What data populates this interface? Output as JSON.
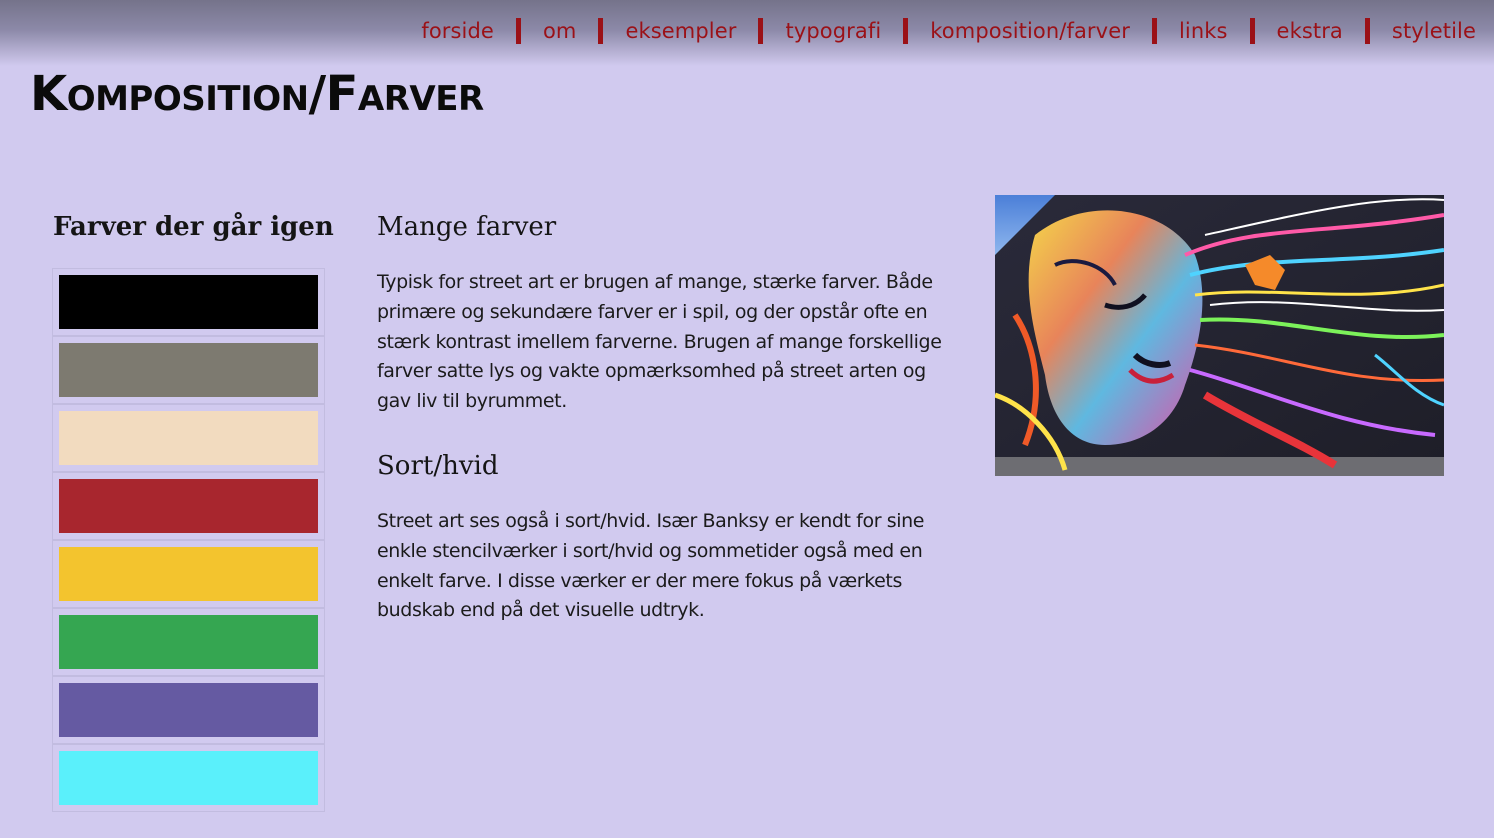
{
  "nav": {
    "items": [
      {
        "label": "forside"
      },
      {
        "label": "om"
      },
      {
        "label": "eksempler"
      },
      {
        "label": "typografi"
      },
      {
        "label": "komposition/farver"
      },
      {
        "label": "links"
      },
      {
        "label": "ekstra"
      },
      {
        "label": "styletile"
      }
    ],
    "link_color": "#9b1117"
  },
  "page": {
    "title": "Komposition/Farver"
  },
  "palette": {
    "heading": "Farver der går igen",
    "colors": [
      "#000000",
      "#7d7a70",
      "#f2dbbf",
      "#a8262e",
      "#f3c42e",
      "#35a651",
      "#655aa2",
      "#5af0fb"
    ]
  },
  "article": {
    "section1": {
      "heading": "Mange farver",
      "body": "Typisk for street art er brugen af mange, stærke farver. Både primære og sekundære farver er i spil, og der opstår ofte en stærk kontrast imellem farverne. Brugen af mange forskellige farver satte lys og vakte opmærksomhed på street arten og gav liv til byrummet."
    },
    "section2": {
      "heading": "Sort/hvid",
      "body": "Street art ses også i sort/hvid. Især Banksy er kendt for sine enkle stencilværker i sort/hvid og sommetider også med en enkelt farve. I disse værker er der mere fokus på værkets budskab end på det visuelle udtryk."
    }
  },
  "colors": {
    "background": "#d1caef",
    "topbar": "#75738a"
  }
}
